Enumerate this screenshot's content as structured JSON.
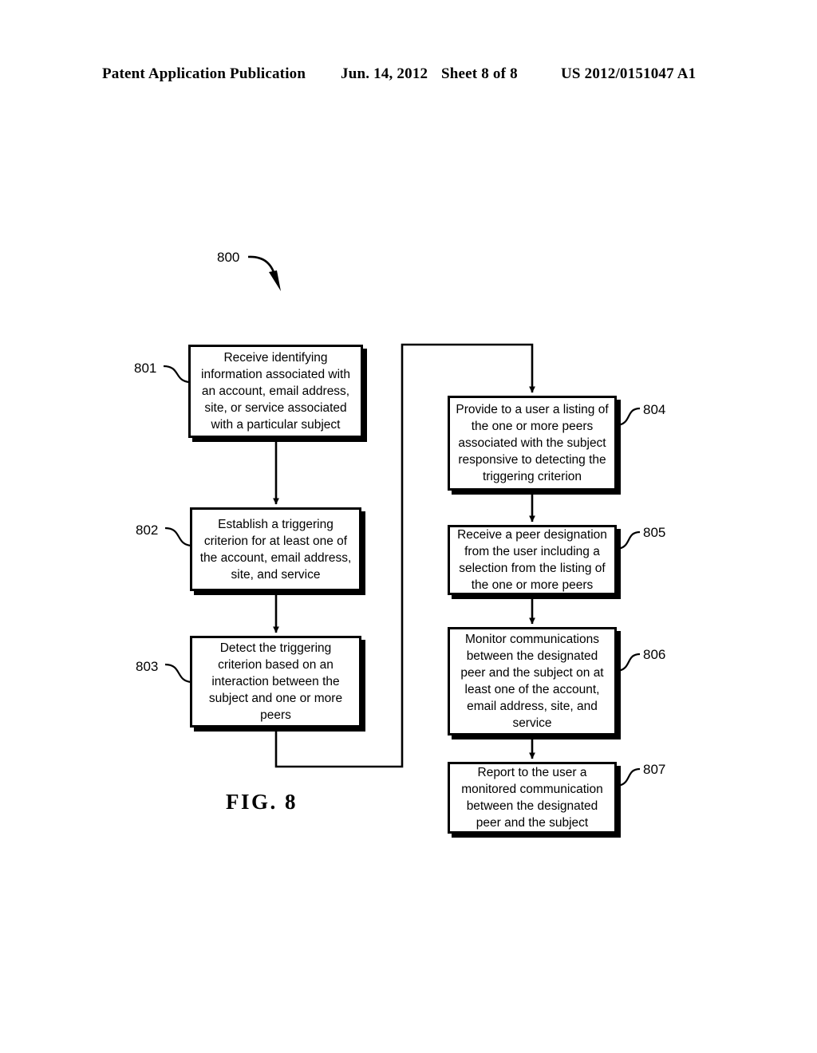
{
  "header": {
    "publication": "Patent Application Publication",
    "date": "Jun. 14, 2012",
    "sheet": "Sheet 8 of 8",
    "number": "US 2012/0151047 A1"
  },
  "figure": {
    "caption": "FIG. 8",
    "diagram_label": "800",
    "type": "flowchart",
    "ink_color": "#000000",
    "background_color": "#ffffff"
  },
  "steps": [
    {
      "ref": "801",
      "text": "Receive identifying\ninformation associated with\nan account, email address,\nsite, or service associated\nwith a particular subject"
    },
    {
      "ref": "802",
      "text": "Establish a triggering\ncriterion for at least one of\nthe account, email address,\nsite, and service"
    },
    {
      "ref": "803",
      "text": "Detect the triggering\ncriterion based on an\ninteraction between the\nsubject and one or more\npeers"
    },
    {
      "ref": "804",
      "text": "Provide to a user a listing of\nthe one or more peers\nassociated with the subject\nresponsive to detecting the\ntriggering criterion"
    },
    {
      "ref": "805",
      "text": "Receive a peer designation\nfrom the user including a\nselection from the listing of\nthe one or more peers"
    },
    {
      "ref": "806",
      "text": "Monitor communications\nbetween the designated\npeer and the subject on at\nleast one of the account,\nemail address, site, and\nservice"
    },
    {
      "ref": "807",
      "text": "Report to the user a\nmonitored communication\nbetween the designated\npeer and the subject"
    }
  ]
}
